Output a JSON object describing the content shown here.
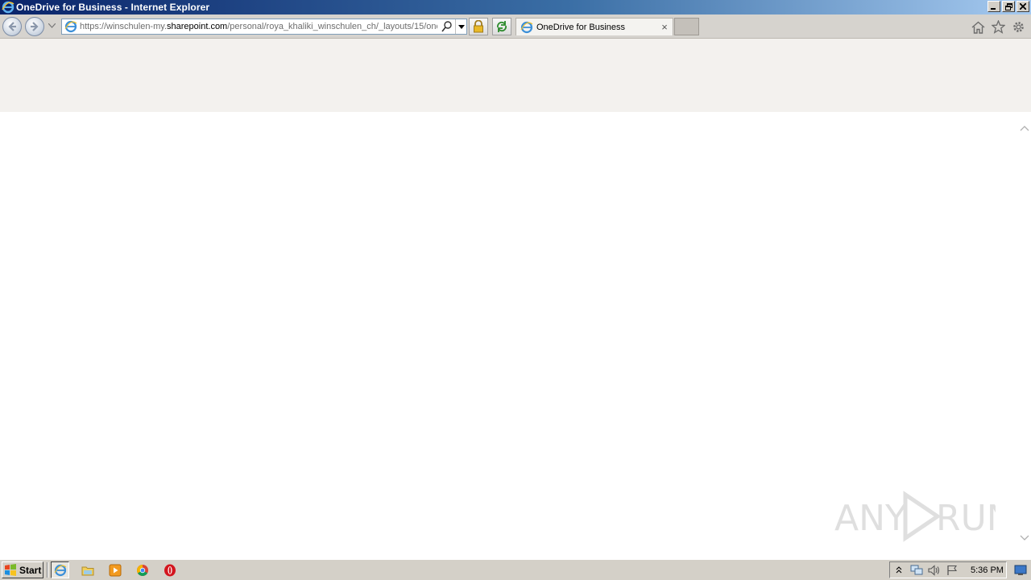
{
  "window": {
    "title": "OneDrive for Business - Internet Explorer",
    "controls": [
      "minimize-icon",
      "restore-icon",
      "close-icon"
    ]
  },
  "navbar": {
    "address_prefix": "https://winschulen-my.",
    "address_domain": "sharepoint.com",
    "address_suffix": "/personal/roya_khaliki_winschulen_ch/_layouts/15/one",
    "tab_title": "OneDrive for Business",
    "tab_close": "×"
  },
  "taskbar": {
    "start_label": "Start",
    "clock": "5:36 PM",
    "quick_launch": [
      "internet-explorer-icon",
      "folder-icon",
      "media-player-icon",
      "chrome-icon",
      "opera-icon"
    ]
  },
  "watermark": {
    "text_left": "ANY",
    "text_right": "RUN"
  },
  "colors": {
    "title_gradient_start": "#0a246a",
    "chrome_bg": "#d6d3ce",
    "suite_bar_bg": "#f3f1ee"
  }
}
